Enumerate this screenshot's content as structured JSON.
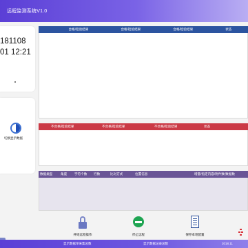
{
  "app": {
    "title": "远程监测系统V1.0"
  },
  "clock": {
    "date": "181108",
    "time": "01 12:21"
  },
  "switch_display": {
    "label": "切换显示数据"
  },
  "panel_qualified": {
    "headers": [
      "合格/检验结果",
      "合格/检验结果",
      "合格/检验结果",
      "状态"
    ]
  },
  "panel_unqualified": {
    "headers": [
      "不合格/检验结果",
      "不合格/检验结果",
      "不合格/检验结果",
      "状态"
    ]
  },
  "panel_data": {
    "headers": [
      "数据类型",
      "角度",
      "字符个数",
      "行数",
      "比对方式",
      "位置信息"
    ],
    "tail_header": "增量/指定内容/附件数/数据数"
  },
  "buttons": {
    "open_port": "开始远程操作",
    "stop_remote": "停止远程",
    "save_config": "保存本地配置"
  },
  "status": {
    "left": "显示数据单采集总数",
    "middle": "显示数据记录总数",
    "right": "2018.11"
  },
  "colors": {
    "title_bar": "#5b3fd6",
    "panel_qualified_header": "#2c54a0",
    "panel_unqualified_header": "#cb3a46",
    "panel_data_header": "#6a5596",
    "stop_button": "#1fa552"
  }
}
